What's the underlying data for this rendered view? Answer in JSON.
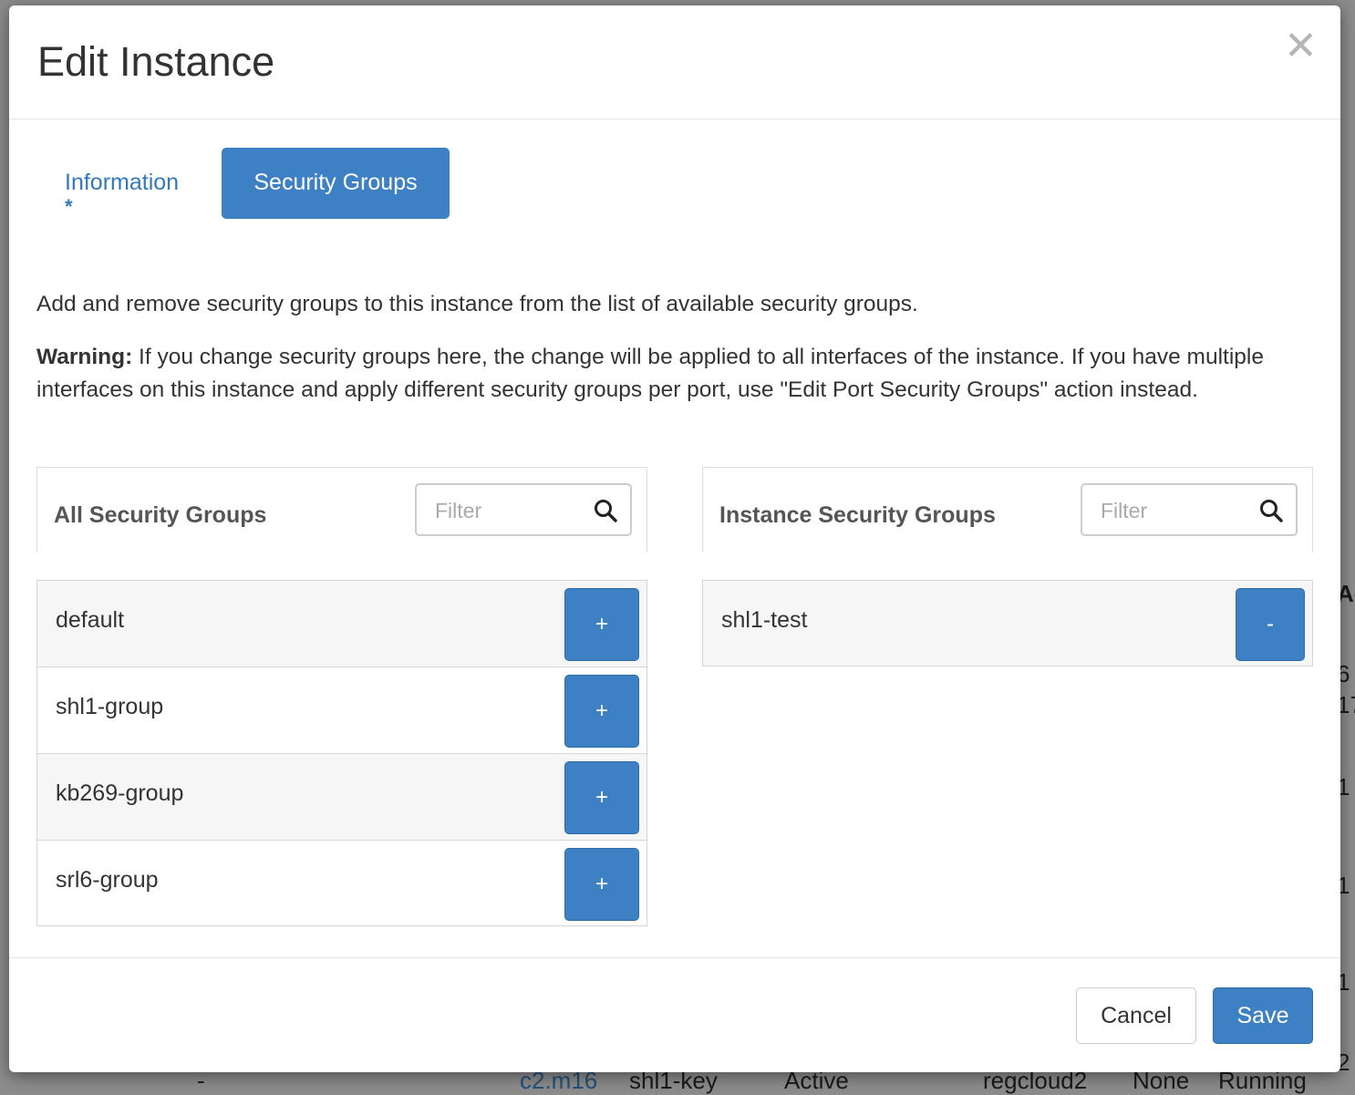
{
  "background": {
    "right_fragments": [
      "Ag",
      "6",
      "17",
      "1",
      "1",
      "1",
      "2"
    ],
    "bottom_fragments": [
      "-",
      "c2.m16",
      "shl1-key",
      "Active",
      "regcloud2",
      "None",
      "Running"
    ]
  },
  "modal": {
    "title": "Edit Instance",
    "close_symbol": "✕"
  },
  "tabs": {
    "information_label": "Information",
    "information_marker": "*",
    "security_groups_label": "Security Groups"
  },
  "content": {
    "description": "Add and remove security groups to this instance from the list of available security groups.",
    "warning_label": "Warning:",
    "warning_text": " If you change security groups here, the change will be applied to all interfaces of the instance. If you have multiple interfaces on this instance and apply different security groups per port, use \"Edit Port Security Groups\" action instead."
  },
  "all_groups": {
    "title": "All Security Groups",
    "filter_placeholder": "Filter",
    "add_label": "+",
    "items": [
      "default",
      "shl1-group",
      "kb269-group",
      "srl6-group"
    ]
  },
  "instance_groups": {
    "title": "Instance Security Groups",
    "filter_placeholder": "Filter",
    "remove_label": "-",
    "items": [
      "shl1-test"
    ]
  },
  "footer": {
    "cancel_label": "Cancel",
    "save_label": "Save"
  },
  "colors": {
    "primary": "#3d80c4",
    "link": "#337ab7",
    "backdrop": "#8c8c8c"
  }
}
